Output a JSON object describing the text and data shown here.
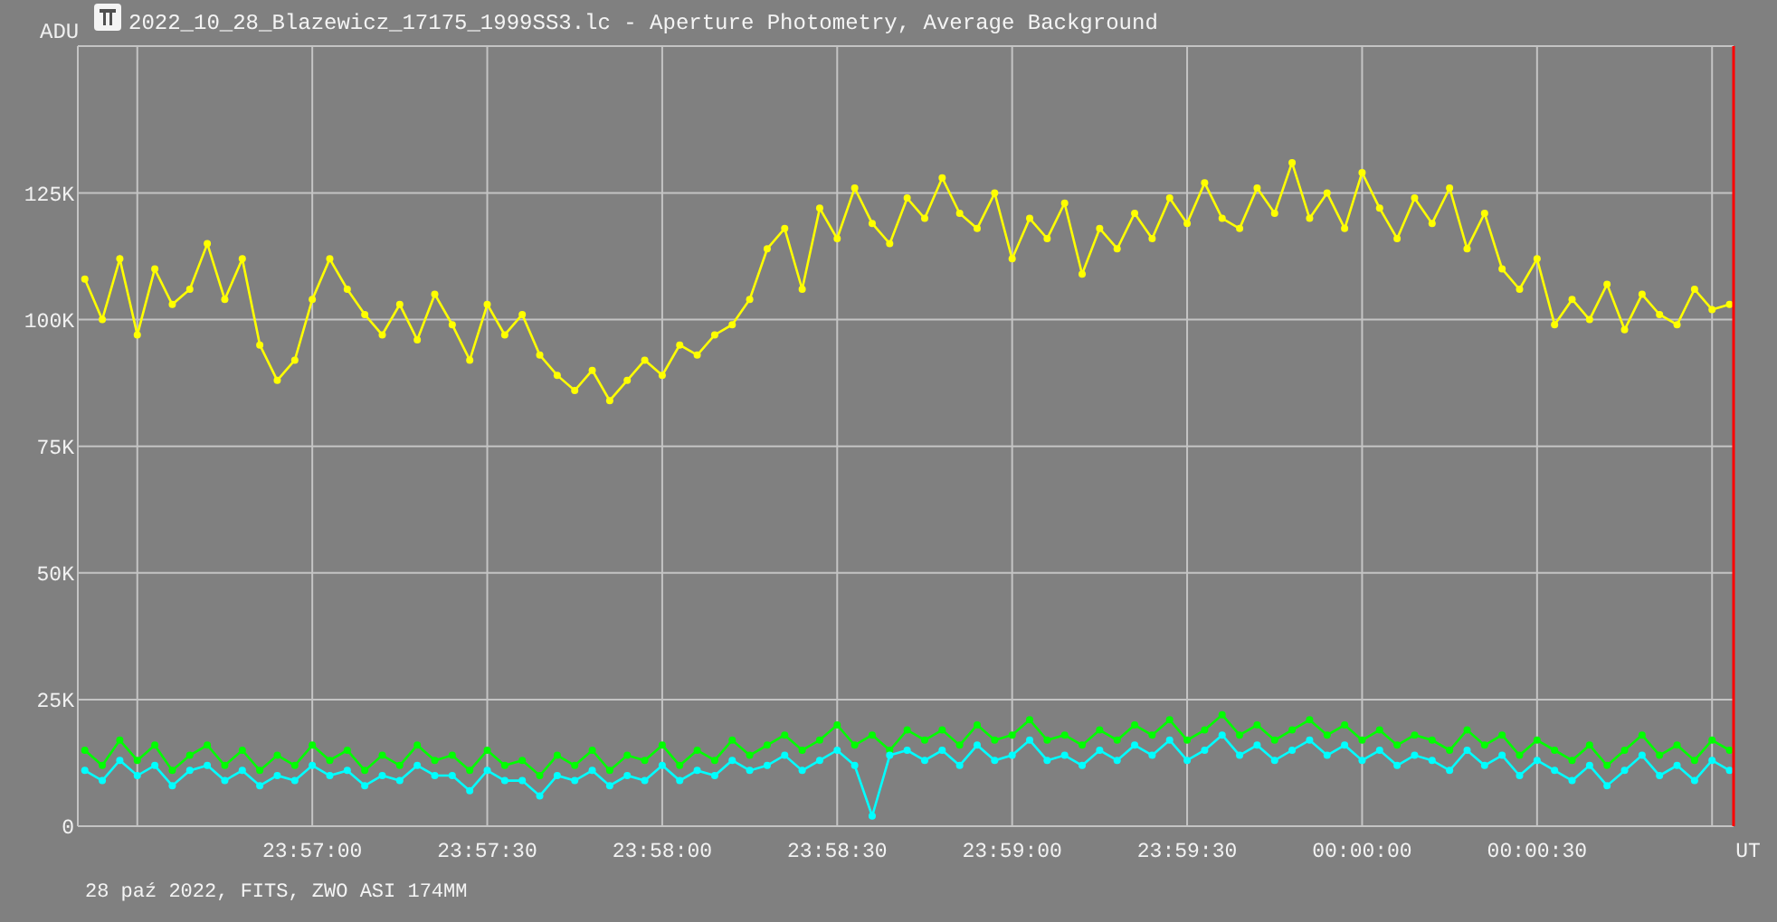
{
  "window": {
    "title": "2022_10_28_Blazewicz_17175_1999SS3.lc - Aperture Photometry, Average Background"
  },
  "chart": {
    "chart_data": {
      "type": "line",
      "ylabel": "ADU",
      "xlabel": "UT",
      "grid": true,
      "ylim": [
        0,
        154000
      ],
      "yticks": [
        {
          "value": 0,
          "label": "0"
        },
        {
          "value": 25000,
          "label": "25K"
        },
        {
          "value": 50000,
          "label": "50K"
        },
        {
          "value": 75000,
          "label": "75K"
        },
        {
          "value": 100000,
          "label": "100K"
        },
        {
          "value": 125000,
          "label": "125K"
        }
      ],
      "categories": [
        null,
        null,
        null,
        null,
        null,
        null,
        null,
        null,
        null,
        null,
        null,
        null,
        null,
        "23:57:00",
        null,
        null,
        null,
        null,
        null,
        null,
        null,
        null,
        null,
        "23:57:30",
        null,
        null,
        null,
        null,
        null,
        null,
        null,
        null,
        null,
        "23:58:00",
        null,
        null,
        null,
        null,
        null,
        null,
        null,
        null,
        null,
        "23:58:30",
        null,
        null,
        null,
        null,
        null,
        null,
        null,
        null,
        null,
        "23:59:00",
        null,
        null,
        null,
        null,
        null,
        null,
        null,
        null,
        null,
        "23:59:30",
        null,
        null,
        null,
        null,
        null,
        null,
        null,
        null,
        null,
        "00:00:00",
        null,
        null,
        null,
        null,
        null,
        null,
        null,
        null,
        null,
        "00:00:30",
        null,
        null,
        null,
        null,
        null,
        null,
        null,
        null,
        null,
        null,
        null
      ],
      "series": [
        {
          "color": "#ffff00",
          "marker": "circle",
          "values": [
            108000,
            100000,
            112000,
            97000,
            110000,
            103000,
            106000,
            115000,
            104000,
            112000,
            95000,
            88000,
            92000,
            104000,
            112000,
            106000,
            101000,
            97000,
            103000,
            96000,
            105000,
            99000,
            92000,
            103000,
            97000,
            101000,
            93000,
            89000,
            86000,
            90000,
            84000,
            88000,
            92000,
            89000,
            95000,
            93000,
            97000,
            99000,
            104000,
            114000,
            118000,
            106000,
            122000,
            116000,
            126000,
            119000,
            115000,
            124000,
            120000,
            128000,
            121000,
            118000,
            125000,
            112000,
            120000,
            116000,
            123000,
            109000,
            118000,
            114000,
            121000,
            116000,
            124000,
            119000,
            127000,
            120000,
            118000,
            126000,
            121000,
            131000,
            120000,
            125000,
            118000,
            129000,
            122000,
            116000,
            124000,
            119000,
            126000,
            114000,
            121000,
            110000,
            106000,
            112000,
            99000,
            104000,
            100000,
            107000,
            98000,
            105000,
            101000,
            99000,
            106000,
            102000,
            103000
          ]
        },
        {
          "color": "#00ff00",
          "marker": "circle",
          "values": [
            15000,
            12000,
            17000,
            13000,
            16000,
            11000,
            14000,
            16000,
            12000,
            15000,
            11000,
            14000,
            12000,
            16000,
            13000,
            15000,
            11000,
            14000,
            12000,
            16000,
            13000,
            14000,
            11000,
            15000,
            12000,
            13000,
            10000,
            14000,
            12000,
            15000,
            11000,
            14000,
            13000,
            16000,
            12000,
            15000,
            13000,
            17000,
            14000,
            16000,
            18000,
            15000,
            17000,
            20000,
            16000,
            18000,
            15000,
            19000,
            17000,
            19000,
            16000,
            20000,
            17000,
            18000,
            21000,
            17000,
            18000,
            16000,
            19000,
            17000,
            20000,
            18000,
            21000,
            17000,
            19000,
            22000,
            18000,
            20000,
            17000,
            19000,
            21000,
            18000,
            20000,
            17000,
            19000,
            16000,
            18000,
            17000,
            15000,
            19000,
            16000,
            18000,
            14000,
            17000,
            15000,
            13000,
            16000,
            12000,
            15000,
            18000,
            14000,
            16000,
            13000,
            17000,
            15000
          ]
        },
        {
          "color": "#00ffff",
          "marker": "circle",
          "values": [
            11000,
            9000,
            13000,
            10000,
            12000,
            8000,
            11000,
            12000,
            9000,
            11000,
            8000,
            10000,
            9000,
            12000,
            10000,
            11000,
            8000,
            10000,
            9000,
            12000,
            10000,
            10000,
            7000,
            11000,
            9000,
            9000,
            6000,
            10000,
            9000,
            11000,
            8000,
            10000,
            9000,
            12000,
            9000,
            11000,
            10000,
            13000,
            11000,
            12000,
            14000,
            11000,
            13000,
            15000,
            12000,
            2000,
            14000,
            15000,
            13000,
            15000,
            12000,
            16000,
            13000,
            14000,
            17000,
            13000,
            14000,
            12000,
            15000,
            13000,
            16000,
            14000,
            17000,
            13000,
            15000,
            18000,
            14000,
            16000,
            13000,
            15000,
            17000,
            14000,
            16000,
            13000,
            15000,
            12000,
            14000,
            13000,
            11000,
            15000,
            12000,
            14000,
            10000,
            13000,
            11000,
            9000,
            12000,
            8000,
            11000,
            14000,
            10000,
            12000,
            9000,
            13000,
            11000
          ]
        }
      ]
    }
  },
  "footer": "28 paź 2022, FITS, ZWO ASI 174MM"
}
